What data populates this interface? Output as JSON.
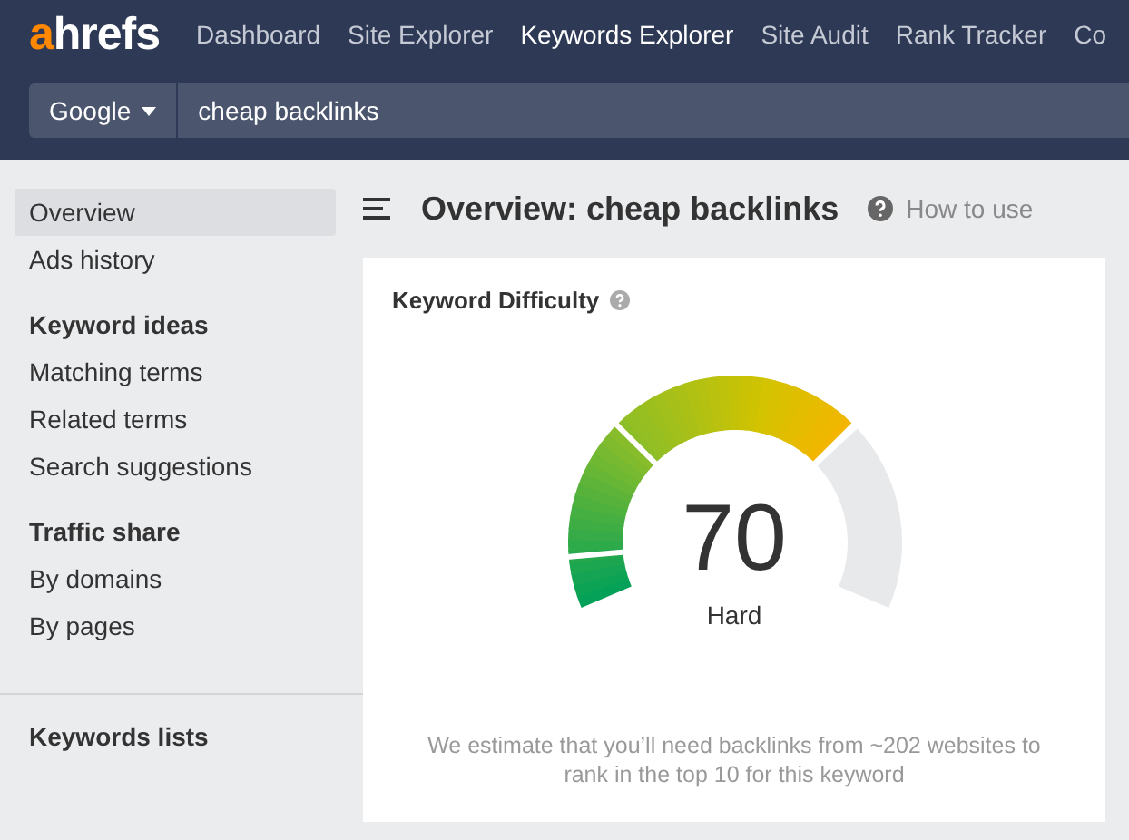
{
  "logo": {
    "accent": "a",
    "rest": "hrefs"
  },
  "nav": [
    {
      "label": "Dashboard",
      "selected": false
    },
    {
      "label": "Site Explorer",
      "selected": false
    },
    {
      "label": "Keywords Explorer",
      "selected": true
    },
    {
      "label": "Site Audit",
      "selected": false
    },
    {
      "label": "Rank Tracker",
      "selected": false
    },
    {
      "label": "Co",
      "selected": false
    }
  ],
  "search": {
    "engine": "Google",
    "value": "cheap backlinks"
  },
  "sidebar": [
    {
      "kind": "item",
      "label": "Overview",
      "selected": true
    },
    {
      "kind": "item",
      "label": "Ads history",
      "selected": false
    },
    {
      "kind": "heading",
      "label": "Keyword ideas"
    },
    {
      "kind": "item",
      "label": "Matching terms",
      "selected": false
    },
    {
      "kind": "item",
      "label": "Related terms",
      "selected": false
    },
    {
      "kind": "item",
      "label": "Search suggestions",
      "selected": false
    },
    {
      "kind": "heading",
      "label": "Traffic share"
    },
    {
      "kind": "item",
      "label": "By domains",
      "selected": false
    },
    {
      "kind": "item",
      "label": "By pages",
      "selected": false
    },
    {
      "kind": "divider"
    },
    {
      "kind": "heading",
      "label": "Keywords lists"
    }
  ],
  "page": {
    "title": "Overview: cheap backlinks",
    "help": "How to use"
  },
  "difficulty": {
    "title": "Keyword Difficulty",
    "score": "70",
    "rating": "Hard",
    "note": "We estimate that you’ll need backlinks from ~202 websites to rank in the top 10 for this keyword"
  }
}
